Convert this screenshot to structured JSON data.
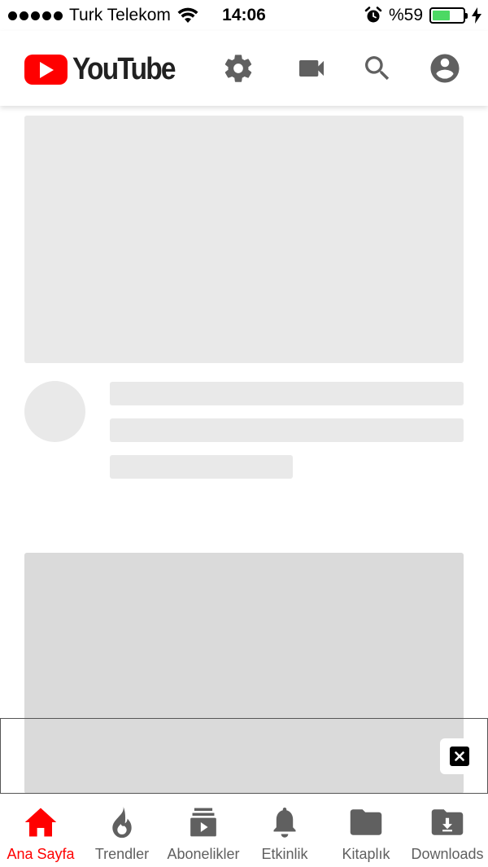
{
  "status_bar": {
    "carrier": "Turk Telekom",
    "time": "14:06",
    "battery": "%59",
    "battery_level": 0.59
  },
  "header": {
    "logo_text": "YouTube"
  },
  "colors": {
    "brand_red": "#ff0000",
    "icon_gray": "#606060",
    "skeleton": "#e9e9e9"
  },
  "bottom_nav": {
    "items": [
      {
        "label": "Ana Sayfa",
        "icon": "home-icon",
        "active": true
      },
      {
        "label": "Trendler",
        "icon": "trending-flame-icon",
        "active": false
      },
      {
        "label": "Abonelikler",
        "icon": "subscriptions-icon",
        "active": false
      },
      {
        "label": "Etkinlik",
        "icon": "bell-icon",
        "active": false
      },
      {
        "label": "Kitaplık",
        "icon": "folder-icon",
        "active": false
      },
      {
        "label": "Downloads",
        "icon": "download-folder-icon",
        "active": false
      }
    ]
  }
}
